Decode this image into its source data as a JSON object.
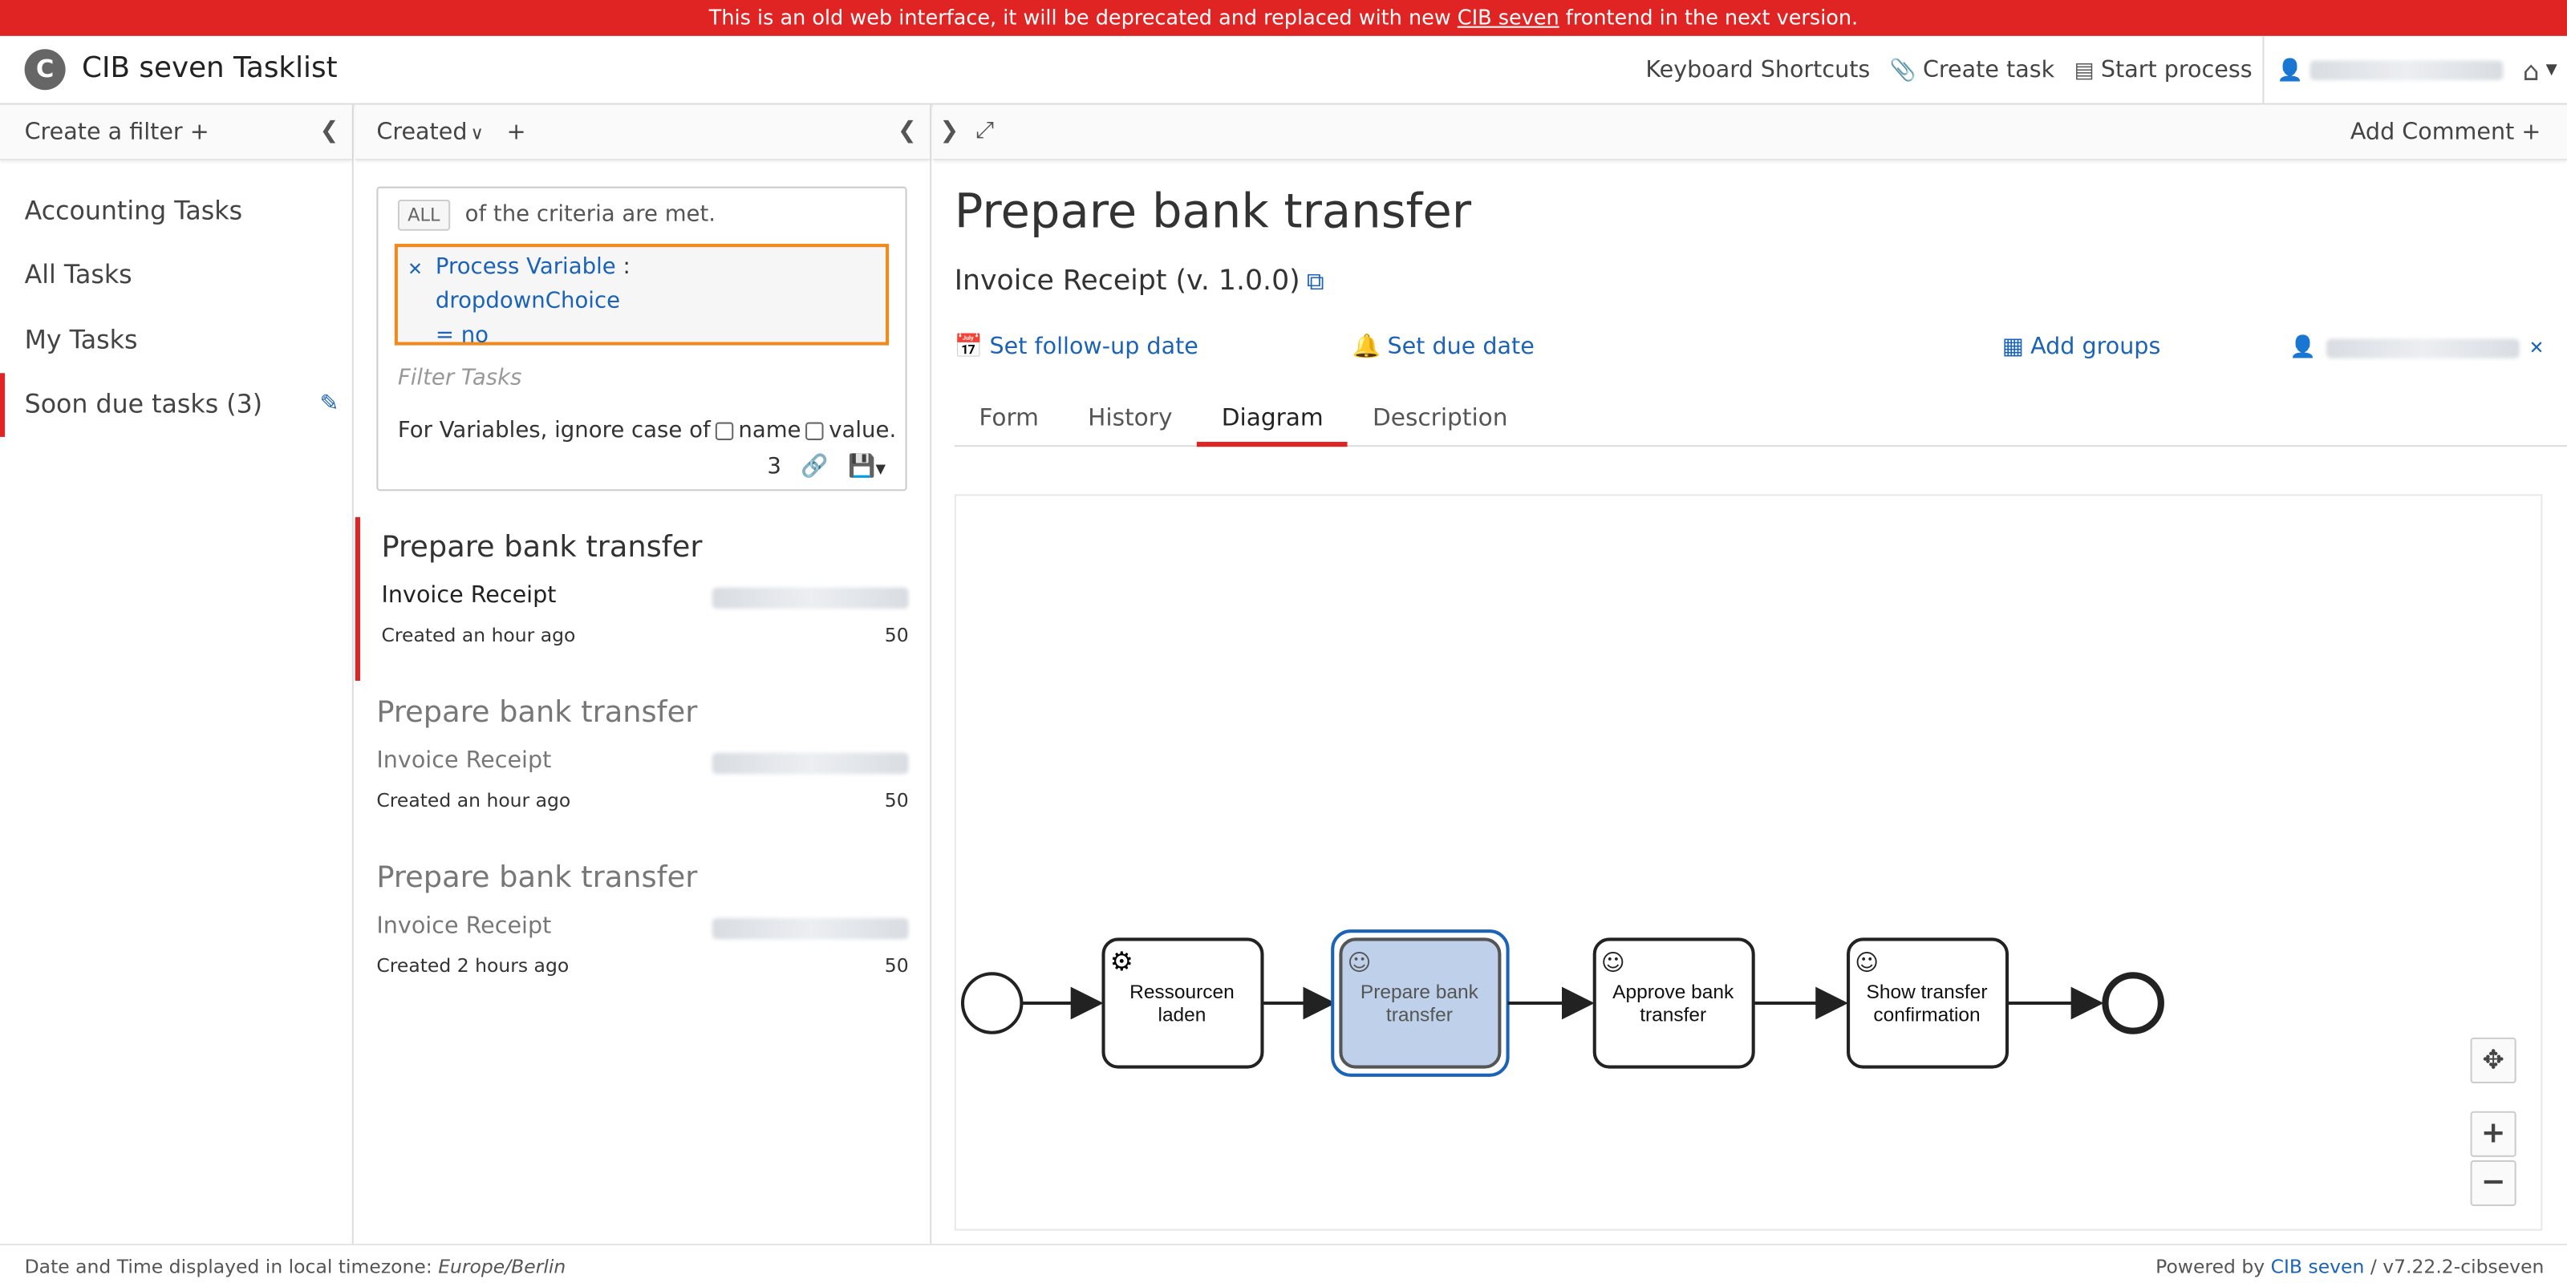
{
  "banner": {
    "before": "This is an old web interface, it will be deprecated and replaced with new ",
    "link": "CIB seven",
    "after": " frontend in the next version."
  },
  "header": {
    "logo_glyph": "C",
    "title": "CIB seven Tasklist",
    "keyboard_shortcuts": "Keyboard Shortcuts",
    "create_task": "Create task",
    "start_process": "Start process"
  },
  "filters": {
    "create_label": "Create a filter",
    "items": [
      {
        "label": "Accounting Tasks"
      },
      {
        "label": "All Tasks"
      },
      {
        "label": "My Tasks"
      },
      {
        "label": "Soon due tasks (3)"
      }
    ]
  },
  "tasklist": {
    "sort_label": "Created",
    "search": {
      "all_label": "ALL",
      "criteria_text": "of the criteria are met.",
      "pill_type": "Process Variable",
      "pill_name": "dropdownChoice",
      "pill_operator": "=",
      "pill_value": "no",
      "placeholder": "Filter Tasks",
      "ignore_case_prefix": "For Variables, ignore case of",
      "ignore_name": "name",
      "ignore_value": "value.",
      "count": "3"
    },
    "tasks": [
      {
        "name": "Prepare bank transfer",
        "process": "Invoice Receipt",
        "created": "Created an hour ago",
        "priority": "50"
      },
      {
        "name": "Prepare bank transfer",
        "process": "Invoice Receipt",
        "created": "Created an hour ago",
        "priority": "50"
      },
      {
        "name": "Prepare bank transfer",
        "process": "Invoice Receipt",
        "created": "Created 2 hours ago",
        "priority": "50"
      }
    ]
  },
  "detail": {
    "add_comment": "Add Comment",
    "title": "Prepare bank transfer",
    "process": "Invoice Receipt (v. 1.0.0)",
    "set_follow_up": "Set follow-up date",
    "set_due": "Set due date",
    "add_groups": "Add groups",
    "tabs": [
      "Form",
      "History",
      "Diagram",
      "Description"
    ],
    "active_tab": "Diagram",
    "diagram": {
      "nodes": [
        {
          "label1": "Ressourcen",
          "label2": "laden",
          "type": "service"
        },
        {
          "label1": "Prepare bank",
          "label2": "transfer",
          "type": "user",
          "active": true
        },
        {
          "label1": "Approve bank",
          "label2": "transfer",
          "type": "user"
        },
        {
          "label1": "Show transfer",
          "label2": "confirmation",
          "type": "user"
        }
      ]
    }
  },
  "footer": {
    "tz_prefix": "Date and Time displayed in local timezone: ",
    "tz": "Europe/Berlin",
    "powered_prefix": "Powered by ",
    "powered_link": "CIB seven",
    "version": " / v7.22.2-cibseven"
  },
  "colors": {
    "banner": "#e02424",
    "link": "#1a63b8",
    "active_accent": "#e02424",
    "search_pill_border": "#f08a1c",
    "active_task_fill": "#bfd1ea"
  }
}
